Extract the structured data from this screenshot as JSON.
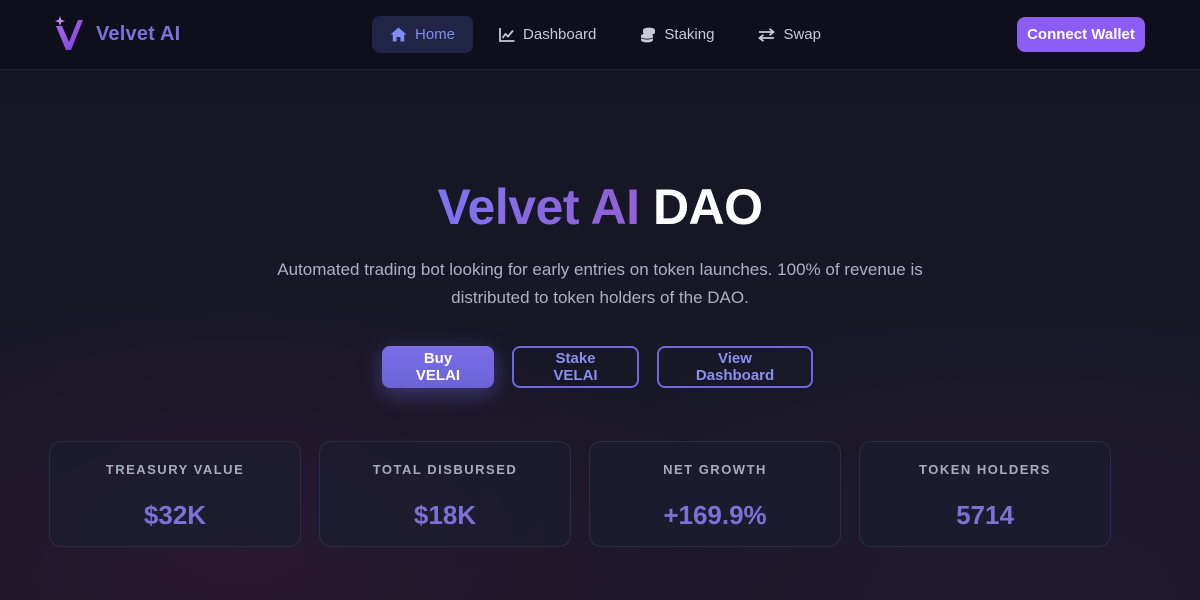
{
  "navbar": {
    "brand": {
      "name": "Velvet AI",
      "logo_icon": "velvet-v-logo"
    },
    "items": [
      {
        "label": "Home",
        "icon": "home-icon",
        "active": true
      },
      {
        "label": "Dashboard",
        "icon": "chart-line-icon",
        "active": false
      },
      {
        "label": "Staking",
        "icon": "coins-icon",
        "active": false
      },
      {
        "label": "Swap",
        "icon": "swap-arrows-icon",
        "active": false
      }
    ],
    "connect_label": "Connect Wallet"
  },
  "hero": {
    "title_highlight": "Velvet AI",
    "title_rest": "DAO",
    "subtitle": "Automated trading bot looking for early entries on token launches. 100% of revenue is distributed to token holders of the DAO.",
    "buttons": {
      "buy": "Buy VELAI",
      "stake": "Stake VELAI",
      "dashboard": "View Dashboard"
    }
  },
  "stats": [
    {
      "label": "TREASURY VALUE",
      "value": "$32K"
    },
    {
      "label": "TOTAL DISBURSED",
      "value": "$18K"
    },
    {
      "label": "NET GROWTH",
      "value": "+169.9%"
    },
    {
      "label": "TOKEN HOLDERS",
      "value": "5714"
    }
  ],
  "colors": {
    "accent": "#8b5cf6",
    "brand_text": "#7b72e0",
    "nav_active_bg": "#202546",
    "stat_value": "#7d70d6",
    "background": "#14141f"
  }
}
